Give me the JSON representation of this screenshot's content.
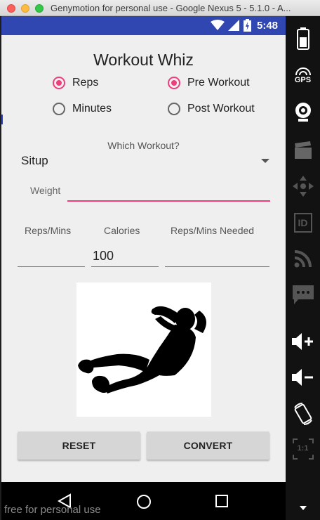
{
  "window": {
    "title": "Genymotion for personal use - Google Nexus 5 - 5.1.0 - A..."
  },
  "statusbar": {
    "time": "5:48",
    "icons": [
      "wifi-icon",
      "signal-icon",
      "battery-charging-icon"
    ]
  },
  "app": {
    "title": "Workout Whiz",
    "radio_unit": [
      {
        "label": "Reps",
        "checked": true
      },
      {
        "label": "Minutes",
        "checked": false
      }
    ],
    "radio_timing": [
      {
        "label": "Pre Workout",
        "checked": true
      },
      {
        "label": "Post Workout",
        "checked": false
      }
    ],
    "which_label": "Which Workout?",
    "workout_selected": "Situp",
    "weight_label": "Weight",
    "weight_value": "",
    "columns": {
      "reps_label": "Reps/Mins",
      "calories_label": "Calories",
      "needed_label": "Reps/Mins Needed"
    },
    "fields": {
      "reps_value": "",
      "calories_value": "100",
      "needed_value": ""
    },
    "image_name": "situp-silhouette",
    "buttons": {
      "reset": "RESET",
      "convert": "CONVERT"
    }
  },
  "toolbar": {
    "gps_label": "GPS",
    "id_label": "ID",
    "scale_label": "1:1"
  },
  "watermark": "free for personal use",
  "colors": {
    "statusbar": "#3046b0",
    "accent": "#ee3f7c",
    "toolbar": "#121212"
  }
}
